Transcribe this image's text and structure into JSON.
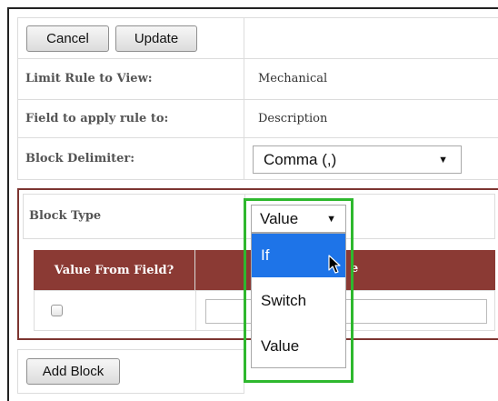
{
  "toolbar": {
    "cancel_label": "Cancel",
    "update_label": "Update"
  },
  "rows": {
    "limit_view_label": "Limit Rule to View:",
    "limit_view_value": "Mechanical",
    "field_label": "Field to apply rule to:",
    "field_value": "Description",
    "delimiter_label": "Block Delimiter:",
    "delimiter_value": "Comma (,)"
  },
  "block": {
    "type_label": "Block Type",
    "type_value": "Value",
    "table_header_col1": "Value From Field?",
    "table_header_col2_visible_fragment": "e",
    "checkbox_checked": false
  },
  "dropdown": {
    "options": [
      "If",
      "Switch",
      "Value"
    ],
    "hovered_index": 0
  },
  "footer": {
    "add_block_label": "Add Block"
  },
  "colors": {
    "table_header_bg": "#8b3a34",
    "block_border": "#7d3531",
    "highlight_green": "#2eb82e",
    "dropdown_hover": "#1e74e8"
  },
  "icons": {
    "dropdown_arrow": "triangle-down",
    "cursor": "arrow-pointer"
  }
}
